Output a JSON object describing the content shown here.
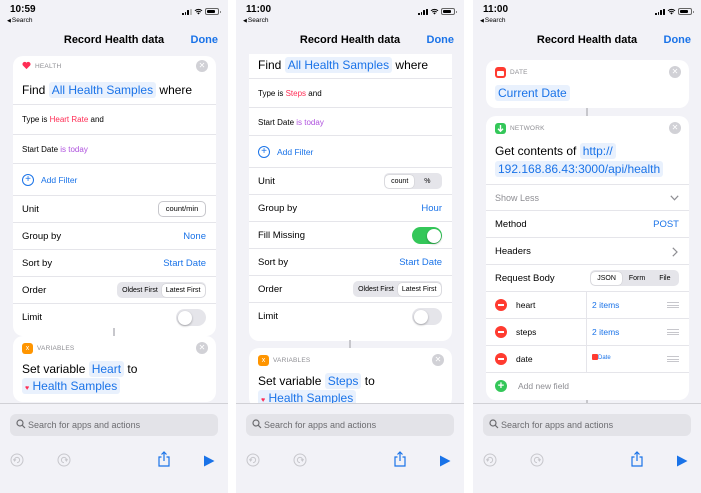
{
  "screens": [
    {
      "status": {
        "time": "10:59",
        "back": "Search"
      },
      "nav": {
        "title": "Record Health data",
        "done": "Done"
      },
      "health_card": {
        "category": "HEALTH",
        "find_word": "Find",
        "find_token": "All Health Samples",
        "where_word": "where",
        "filter1_type": "Type",
        "filter1_is": "is",
        "filter1_value": "Heart Rate",
        "filter1_and": "and",
        "filter2_label": "Start Date",
        "filter2_value": "is today",
        "add_filter": "Add Filter",
        "unit_label": "Unit",
        "unit_value": "count/min",
        "group_label": "Group by",
        "group_value": "None",
        "sort_label": "Sort by",
        "sort_value": "Start Date",
        "order_label": "Order",
        "order_opt1": "Oldest First",
        "order_opt2": "Latest First",
        "limit_label": "Limit"
      },
      "var_card": {
        "category": "VARIABLES",
        "set_word": "Set variable",
        "var_name": "Heart",
        "to_word": "to",
        "value": "Health Samples"
      },
      "search_placeholder": "Search for apps and actions"
    },
    {
      "status": {
        "time": "11:00",
        "back": "Search"
      },
      "nav": {
        "title": "Record Health data",
        "done": "Done"
      },
      "health_card": {
        "find_word": "Find",
        "find_token": "All Health Samples",
        "where_word": "where",
        "filter1_type": "Type",
        "filter1_is": "is",
        "filter1_value": "Steps",
        "filter1_and": "and",
        "filter2_label": "Start Date",
        "filter2_value": "is today",
        "add_filter": "Add Filter",
        "unit_label": "Unit",
        "unit_opt1": "count",
        "unit_opt2": "%",
        "group_label": "Group by",
        "group_value": "Hour",
        "fill_label": "Fill Missing",
        "sort_label": "Sort by",
        "sort_value": "Start Date",
        "order_label": "Order",
        "order_opt1": "Oldest First",
        "order_opt2": "Latest First",
        "limit_label": "Limit"
      },
      "var_card": {
        "category": "VARIABLES",
        "set_word": "Set variable",
        "var_name": "Steps",
        "to_word": "to",
        "value": "Health Samples"
      },
      "search_placeholder": "Search for apps and actions"
    },
    {
      "status": {
        "time": "11:00",
        "back": "Search"
      },
      "nav": {
        "title": "Record Health data",
        "done": "Done"
      },
      "date_card": {
        "category": "DATE",
        "token": "Current Date"
      },
      "network_card": {
        "category": "NETWORK",
        "get_word": "Get contents of",
        "url_line1": "http://",
        "url_line2": "192.168.86.43:3000/api/health",
        "show_less": "Show Less",
        "method_label": "Method",
        "method_value": "POST",
        "headers_label": "Headers",
        "body_label": "Request Body",
        "body_opt1": "JSON",
        "body_opt2": "Form",
        "body_opt3": "File",
        "fields": [
          {
            "key": "heart",
            "value": "2 items"
          },
          {
            "key": "steps",
            "value": "2 items"
          },
          {
            "key": "date",
            "value": "Date"
          }
        ],
        "add_field": "Add new field"
      },
      "search_placeholder": "Search for apps and actions"
    }
  ],
  "colors": {
    "accent": "#1a73e8",
    "health_pink": "#ff2d55",
    "variables_orange": "#ff9500",
    "network_green": "#34c759",
    "date_red": "#ff3b30"
  }
}
